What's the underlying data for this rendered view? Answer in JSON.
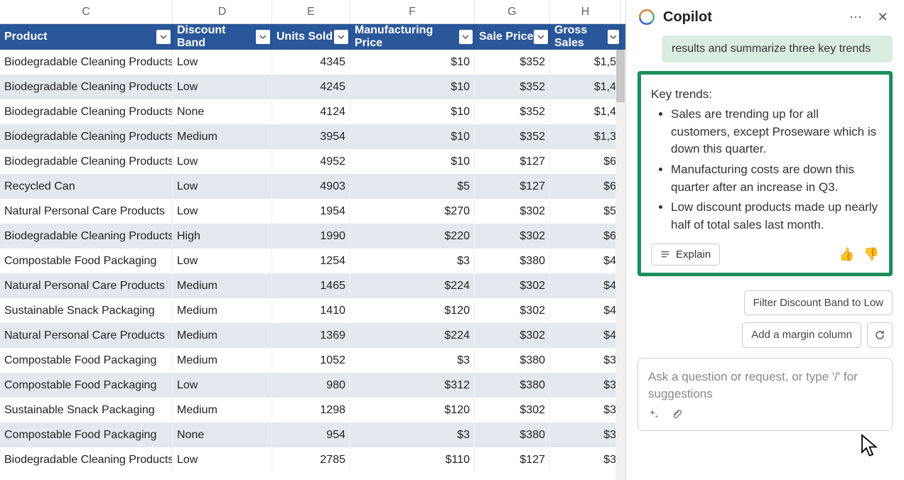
{
  "columns": {
    "letters": [
      "C",
      "D",
      "E",
      "F",
      "G",
      "H"
    ],
    "headers": [
      "Product",
      "Discount Band",
      "Units Sold",
      "Manufacturing Price",
      "Sale Price",
      "Gross Sales"
    ]
  },
  "rows": [
    {
      "product": "Biodegradable Cleaning Products",
      "band": "Low",
      "units": "4345",
      "mfg": "$10",
      "sale": "$352",
      "gross": "$1,5"
    },
    {
      "product": "Biodegradable Cleaning Products",
      "band": "Low",
      "units": "4245",
      "mfg": "$10",
      "sale": "$352",
      "gross": "$1,4"
    },
    {
      "product": "Biodegradable Cleaning Products",
      "band": "None",
      "units": "4124",
      "mfg": "$10",
      "sale": "$352",
      "gross": "$1,4"
    },
    {
      "product": "Biodegradable Cleaning Products",
      "band": "Medium",
      "units": "3954",
      "mfg": "$10",
      "sale": "$352",
      "gross": "$1,3"
    },
    {
      "product": "Biodegradable Cleaning Products",
      "band": "Low",
      "units": "4952",
      "mfg": "$10",
      "sale": "$127",
      "gross": "$6"
    },
    {
      "product": "Recycled Can",
      "band": "Low",
      "units": "4903",
      "mfg": "$5",
      "sale": "$127",
      "gross": "$6"
    },
    {
      "product": "Natural Personal Care Products",
      "band": "Low",
      "units": "1954",
      "mfg": "$270",
      "sale": "$302",
      "gross": "$5"
    },
    {
      "product": "Biodegradable Cleaning Products",
      "band": "High",
      "units": "1990",
      "mfg": "$220",
      "sale": "$302",
      "gross": "$6"
    },
    {
      "product": "Compostable Food Packaging",
      "band": "Low",
      "units": "1254",
      "mfg": "$3",
      "sale": "$380",
      "gross": "$4"
    },
    {
      "product": "Natural Personal Care Products",
      "band": "Medium",
      "units": "1465",
      "mfg": "$224",
      "sale": "$302",
      "gross": "$4"
    },
    {
      "product": "Sustainable Snack Packaging",
      "band": "Medium",
      "units": "1410",
      "mfg": "$120",
      "sale": "$302",
      "gross": "$4"
    },
    {
      "product": "Natural Personal Care Products",
      "band": "Medium",
      "units": "1369",
      "mfg": "$224",
      "sale": "$302",
      "gross": "$4"
    },
    {
      "product": "Compostable Food Packaging",
      "band": "Medium",
      "units": "1052",
      "mfg": "$3",
      "sale": "$380",
      "gross": "$3"
    },
    {
      "product": "Compostable Food Packaging",
      "band": "Low",
      "units": "980",
      "mfg": "$312",
      "sale": "$380",
      "gross": "$3"
    },
    {
      "product": "Sustainable Snack Packaging",
      "band": "Medium",
      "units": "1298",
      "mfg": "$120",
      "sale": "$302",
      "gross": "$3"
    },
    {
      "product": "Compostable Food Packaging",
      "band": "None",
      "units": "954",
      "mfg": "$3",
      "sale": "$380",
      "gross": "$3"
    },
    {
      "product": "Biodegradable Cleaning Products",
      "band": "Low",
      "units": "2785",
      "mfg": "$110",
      "sale": "$127",
      "gross": "$3"
    }
  ],
  "copilot": {
    "title": "Copilot",
    "user_prompt": "results and summarize three key trends",
    "response_lead": "Key trends:",
    "bullets": [
      "Sales are trending up for all customers, except Proseware which is down this quarter.",
      "Manufacturing costs are down this quarter after an increase in Q3.",
      "Low discount products made up nearly half of total sales last month."
    ],
    "explain_label": "Explain",
    "suggestions": {
      "filter": "Filter Discount Band to Low",
      "margin": "Add a margin column"
    },
    "input_placeholder": "Ask a question or request, or type '/' for suggestions"
  }
}
